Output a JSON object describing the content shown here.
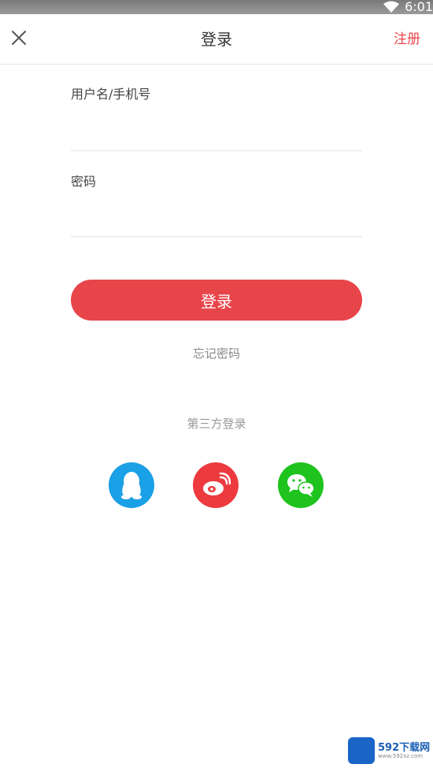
{
  "status_bar": {
    "time": "6:01"
  },
  "header": {
    "title": "登录",
    "register_label": "注册"
  },
  "form": {
    "username_label": "用户名/手机号",
    "username_value": "",
    "password_label": "密码",
    "password_value": "",
    "login_button_label": "登录",
    "forgot_password_label": "忘记密码"
  },
  "third_party": {
    "title": "第三方登录",
    "providers": [
      {
        "name": "qq",
        "color": "#1aa0e6"
      },
      {
        "name": "weibo",
        "color": "#ec3a3f"
      },
      {
        "name": "wechat",
        "color": "#1ec31e"
      }
    ]
  },
  "watermark": {
    "brand": "592下载网",
    "url": "www.592xz.com"
  },
  "colors": {
    "accent": "#e8454a"
  }
}
